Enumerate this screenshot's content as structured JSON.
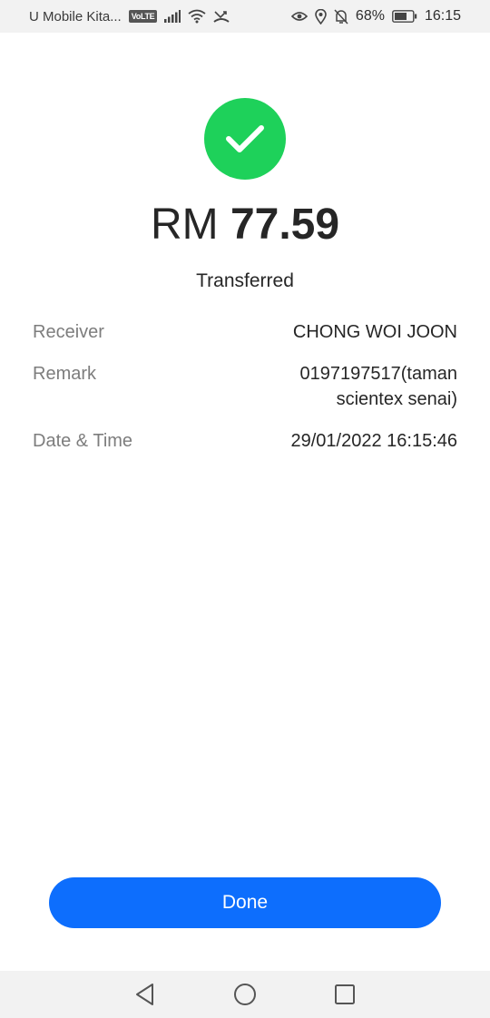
{
  "status_bar": {
    "carrier": "U Mobile Kita...",
    "volte": "VoLTE",
    "battery": "68%",
    "time": "16:15",
    "icons": [
      "signal-icon",
      "wifi-icon",
      "missed-call-icon",
      "eye-icon",
      "location-icon",
      "bell-off-icon",
      "battery-icon"
    ]
  },
  "receipt": {
    "success_icon": "check-circle-icon",
    "success_color": "#1ed15a",
    "currency": "RM",
    "amount": "77.59",
    "status": "Transferred",
    "details": [
      {
        "label": "Receiver",
        "value": "CHONG WOI JOON"
      },
      {
        "label": "Remark",
        "value": "0197197517(taman scientex senai)"
      },
      {
        "label": "Date & Time",
        "value": "29/01/2022 16:15:46"
      }
    ]
  },
  "actions": {
    "done_label": "Done",
    "done_color": "#0d6efd"
  },
  "nav_bar": {
    "icons": [
      "back-icon",
      "home-icon",
      "recents-icon"
    ]
  }
}
